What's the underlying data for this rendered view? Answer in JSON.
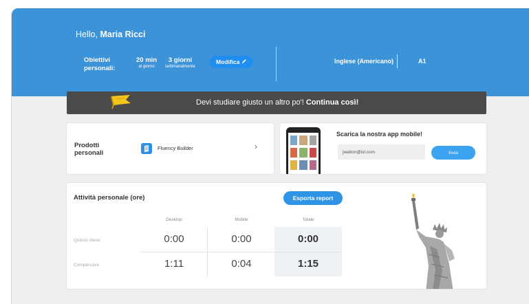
{
  "header": {
    "greeting_prefix": "Hello,",
    "user_name": "Maria Ricci",
    "goals_label": "Obiettivi personali:",
    "goal_minutes": {
      "value": "20 min",
      "caption": "al giorno"
    },
    "goal_days": {
      "value": "3 giorni",
      "caption": "settimanalmente"
    },
    "edit_label": "Modifica",
    "edit_icon": "pencil-icon",
    "language": "Inglese (Americano)",
    "level": "A1"
  },
  "banner": {
    "message": "Devi studiare giusto un altro po'!",
    "emphasis": "Continua così!",
    "icon": "flag-icon"
  },
  "products": {
    "title": "Prodotti personali",
    "item_name": "Fluency Builder",
    "item_icon": "fluency-builder-logo"
  },
  "app_promo": {
    "title": "Scarica la nostra app mobile!",
    "email_value": "jwalton@ixl.com",
    "send_label": "Invia"
  },
  "activity": {
    "title": "Attività personale (ore)",
    "export_label": "Esporta report",
    "columns": [
      "Desktop",
      "Mobile",
      "Totale"
    ],
    "rows": [
      {
        "label": "Questo mese",
        "desktop": "0:00",
        "mobile": "0:00",
        "total": "0:00"
      },
      {
        "label": "Complessive",
        "desktop": "1:11",
        "mobile": "0:04",
        "total": "1:15"
      }
    ]
  },
  "colors": {
    "hero": "#3d93d8",
    "accent": "#1f8ef0",
    "banner": "#4a4a4a",
    "background": "#efefef"
  }
}
